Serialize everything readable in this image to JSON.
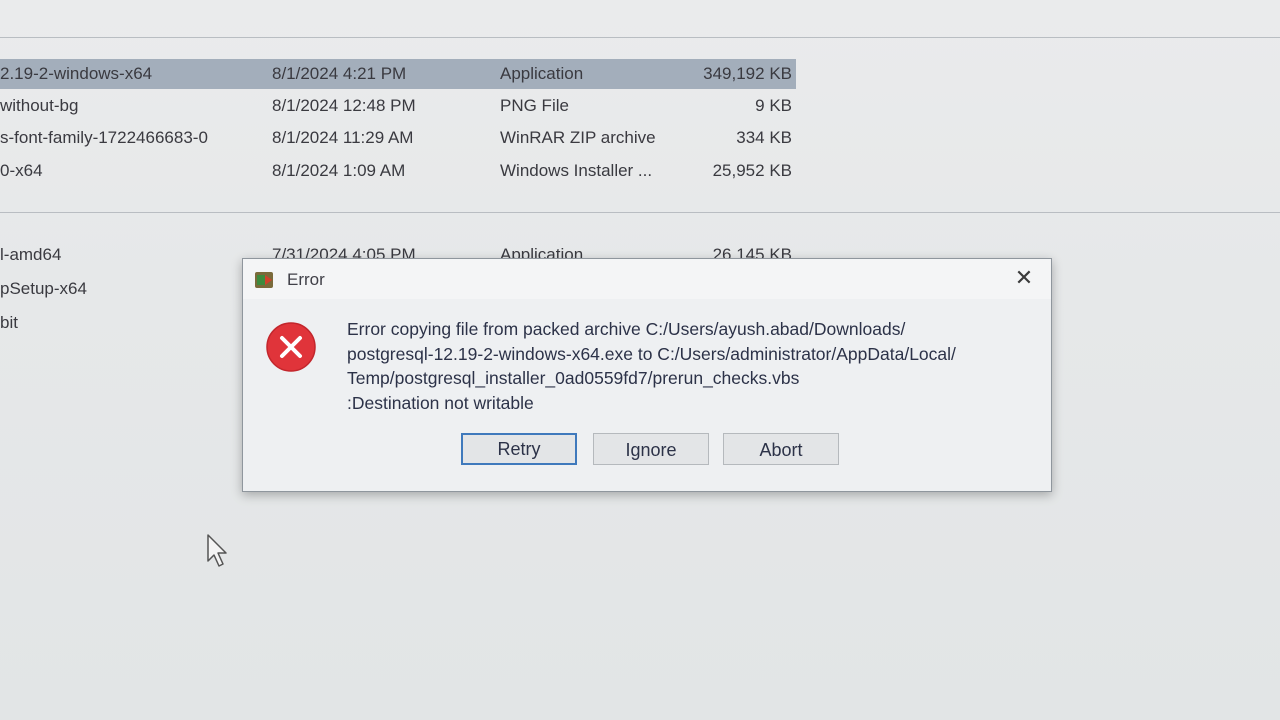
{
  "files": {
    "group1": [
      {
        "name": "2.19-2-windows-x64",
        "date": "8/1/2024 4:21 PM",
        "type": "Application",
        "size": "349,192 KB",
        "selected": true
      },
      {
        "name": "without-bg",
        "date": "8/1/2024 12:48 PM",
        "type": "PNG File",
        "size": "9 KB"
      },
      {
        "name": "s-font-family-1722466683-0",
        "date": "8/1/2024 11:29 AM",
        "type": "WinRAR ZIP archive",
        "size": "334 KB"
      },
      {
        "name": "0-x64",
        "date": "8/1/2024 1:09 AM",
        "type": "Windows Installer ...",
        "size": "25,952 KB"
      }
    ],
    "group2": [
      {
        "name": "l-amd64",
        "date": "7/31/2024 4:05 PM",
        "type": "Application",
        "size": "26,145 KB"
      },
      {
        "name": "pSetup-x64"
      },
      {
        "name": "bit"
      }
    ]
  },
  "dialog": {
    "title": "Error",
    "close_icon": "close-icon",
    "error_icon": "error-x-icon",
    "message_lines": [
      "Error copying file from packed archive C:/Users/ayush.abad/Downloads/",
      "postgresql-12.19-2-windows-x64.exe to C:/Users/administrator/AppData/Local/",
      "Temp/postgresql_installer_0ad0559fd7/prerun_checks.vbs",
      ":Destination not writable"
    ],
    "buttons": {
      "retry": "Retry",
      "ignore": "Ignore",
      "abort": "Abort"
    },
    "colors": {
      "error_red": "#e0343a",
      "default_button_border": "#3f79bc",
      "selection": "#a3aebb"
    }
  }
}
